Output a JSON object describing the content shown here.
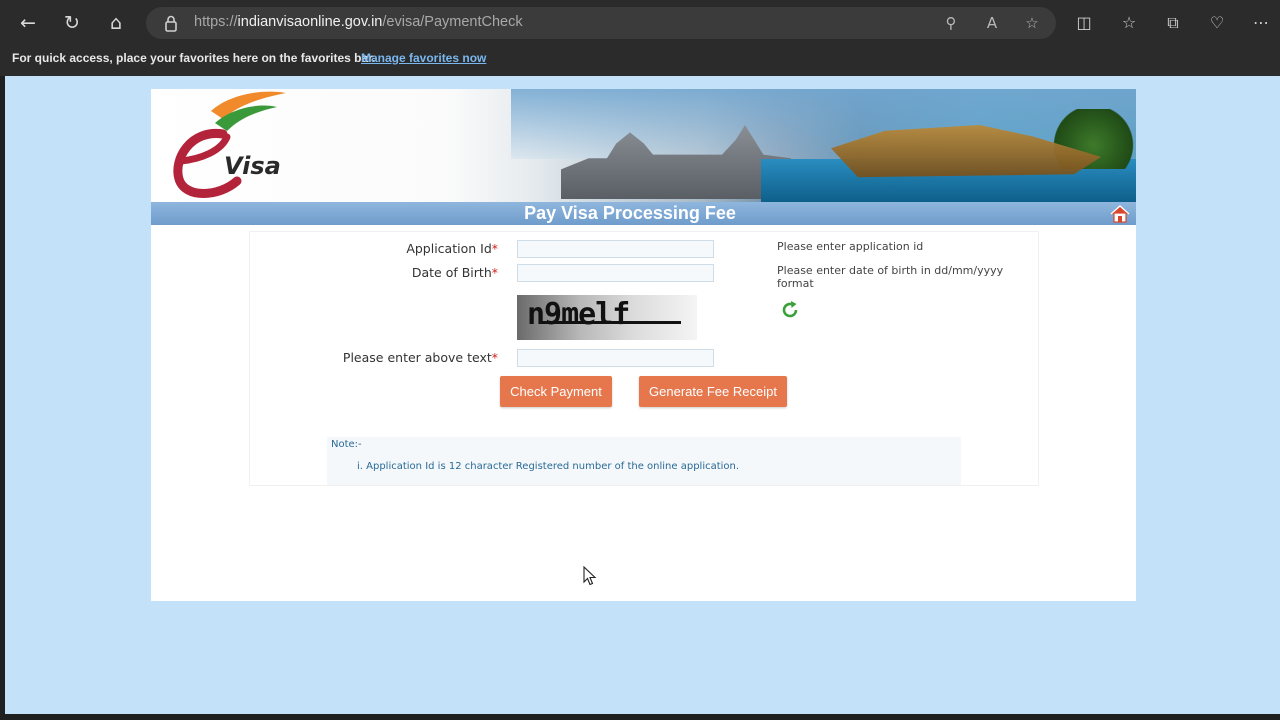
{
  "browser": {
    "url_prefix": "https://",
    "url_host": "indianvisaonline.gov.in",
    "url_path": "/evisa/PaymentCheck",
    "favorites_message": "For quick access, place your favorites here on the favorites bar.",
    "favorites_link": "Manage favorites now"
  },
  "banner": {
    "logo_text": "Visa",
    "logo_letter": "e"
  },
  "page": {
    "title": "Pay Visa Processing Fee"
  },
  "form": {
    "application_id_label": "Application Id",
    "dob_label": "Date of Birth",
    "captcha_label": "Please enter above text",
    "required_mark": "*",
    "application_id_value": "",
    "dob_value": "",
    "captcha_value": "",
    "application_id_hint": "Please enter application id",
    "dob_hint": "Please enter date of birth in dd/mm/yyyy format",
    "captcha_text": "n9melf"
  },
  "buttons": {
    "check_payment": "Check Payment",
    "generate_receipt": "Generate Fee Receipt"
  },
  "note": {
    "heading": "Note:-",
    "items": [
      "i. Application Id is 12 character Registered number of the online application."
    ]
  },
  "colors": {
    "button": "#e6774d",
    "title_bar": "#7ba5d3",
    "viewport_bg": "#c3e1f8"
  }
}
